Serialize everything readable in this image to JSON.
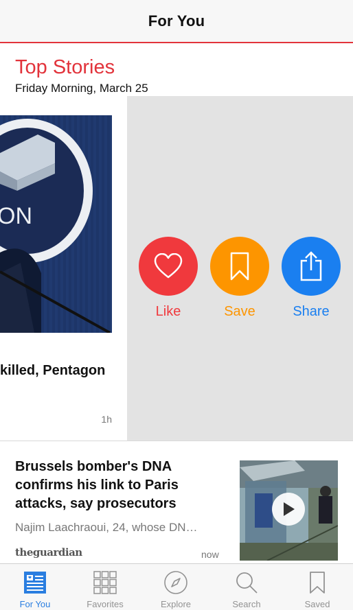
{
  "nav": {
    "title": "For You"
  },
  "section": {
    "title": "Top Stories",
    "date": "Friday Morning, March 25"
  },
  "top_card": {
    "headline": "killed, Pentagon",
    "time": "1h",
    "image_text": "ON"
  },
  "actions": {
    "like": {
      "label": "Like",
      "color": "#f0393d",
      "icon": "heart-icon"
    },
    "save": {
      "label": "Save",
      "color": "#fd9500",
      "icon": "bookmark-icon"
    },
    "share": {
      "label": "Share",
      "color": "#1a7ff0",
      "icon": "share-icon"
    }
  },
  "article2": {
    "headline": "Brussels bomber's DNA confirms his link to Paris attacks, say prosecutors",
    "excerpt": "Najim Laachraoui, 24, whose DN…",
    "source": "theguardian",
    "time": "now"
  },
  "tabs": [
    {
      "label": "For You",
      "icon": "newspaper-icon",
      "active": true
    },
    {
      "label": "Favorites",
      "icon": "grid-icon",
      "active": false
    },
    {
      "label": "Explore",
      "icon": "compass-icon",
      "active": false
    },
    {
      "label": "Search",
      "icon": "search-icon",
      "active": false
    },
    {
      "label": "Saved",
      "icon": "bookmark-icon",
      "active": false
    }
  ],
  "colors": {
    "accent": "#e2333b",
    "tab_active": "#2a7ee0",
    "tab_inactive": "#929292"
  }
}
